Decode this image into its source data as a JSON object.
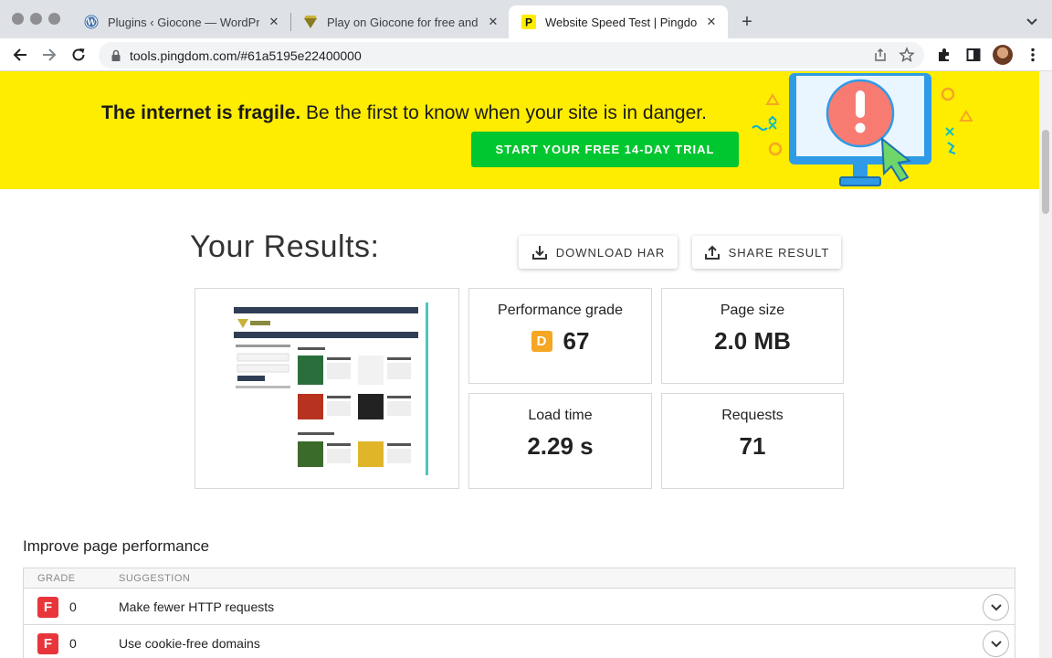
{
  "browser": {
    "tabs": [
      {
        "title": "Plugins ‹ Giocone — WordPress",
        "favicon": "wordpress-icon"
      },
      {
        "title": "Play on Giocone for free and online",
        "favicon": "diamond-icon"
      },
      {
        "title": "Website Speed Test | Pingdom Tools",
        "favicon": "pingdom-icon"
      }
    ],
    "new_tab": "+",
    "url": "tools.pingdom.com/#61a5195e22400000"
  },
  "banner": {
    "headline_bold": "The internet is fragile.",
    "headline_rest": " Be the first to know when your site is in danger.",
    "cta": "START YOUR FREE 14-DAY TRIAL"
  },
  "results": {
    "title": "Your Results:",
    "download_har": "DOWNLOAD HAR",
    "share_result": "SHARE RESULT",
    "performance": {
      "label": "Performance grade",
      "grade": "D",
      "score": "67"
    },
    "page_size": {
      "label": "Page size",
      "value": "2.0 MB"
    },
    "load_time": {
      "label": "Load time",
      "value": "2.29 s"
    },
    "requests": {
      "label": "Requests",
      "value": "71"
    }
  },
  "improve": {
    "title": "Improve page performance",
    "headers": {
      "grade": "GRADE",
      "suggestion": "SUGGESTION"
    },
    "rows": [
      {
        "grade": "F",
        "score": "0",
        "suggestion": "Make fewer HTTP requests"
      },
      {
        "grade": "F",
        "score": "0",
        "suggestion": "Use cookie-free domains"
      }
    ]
  },
  "colors": {
    "banner_yellow": "#ffed00",
    "cta_green": "#00c62f",
    "grade_d": "#f5a623",
    "grade_f": "#e8353b"
  }
}
